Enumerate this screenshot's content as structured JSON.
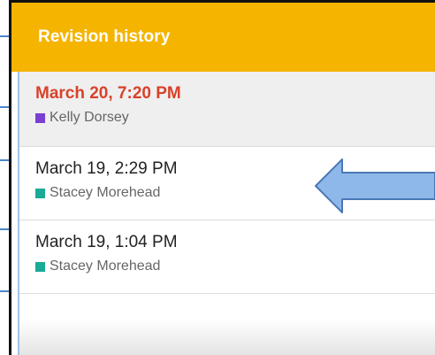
{
  "panel": {
    "title": "Revision history"
  },
  "revisions": [
    {
      "date": "March 20, 7:20 PM",
      "author": "Kelly Dorsey",
      "color": "#7b3fd1",
      "current": true
    },
    {
      "date": "March 19, 2:29 PM",
      "author": "Stacey Morehead",
      "color": "#1aaa95",
      "current": false
    },
    {
      "date": "March 19, 1:04 PM",
      "author": "Stacey Morehead",
      "color": "#1aaa95",
      "current": false
    }
  ],
  "colors": {
    "header": "#f5b400",
    "current_date": "#d9412b",
    "arrow_fill": "#8fb8ea",
    "arrow_stroke": "#4a78b5"
  },
  "annotation": {
    "icon": "left-arrow-icon"
  }
}
